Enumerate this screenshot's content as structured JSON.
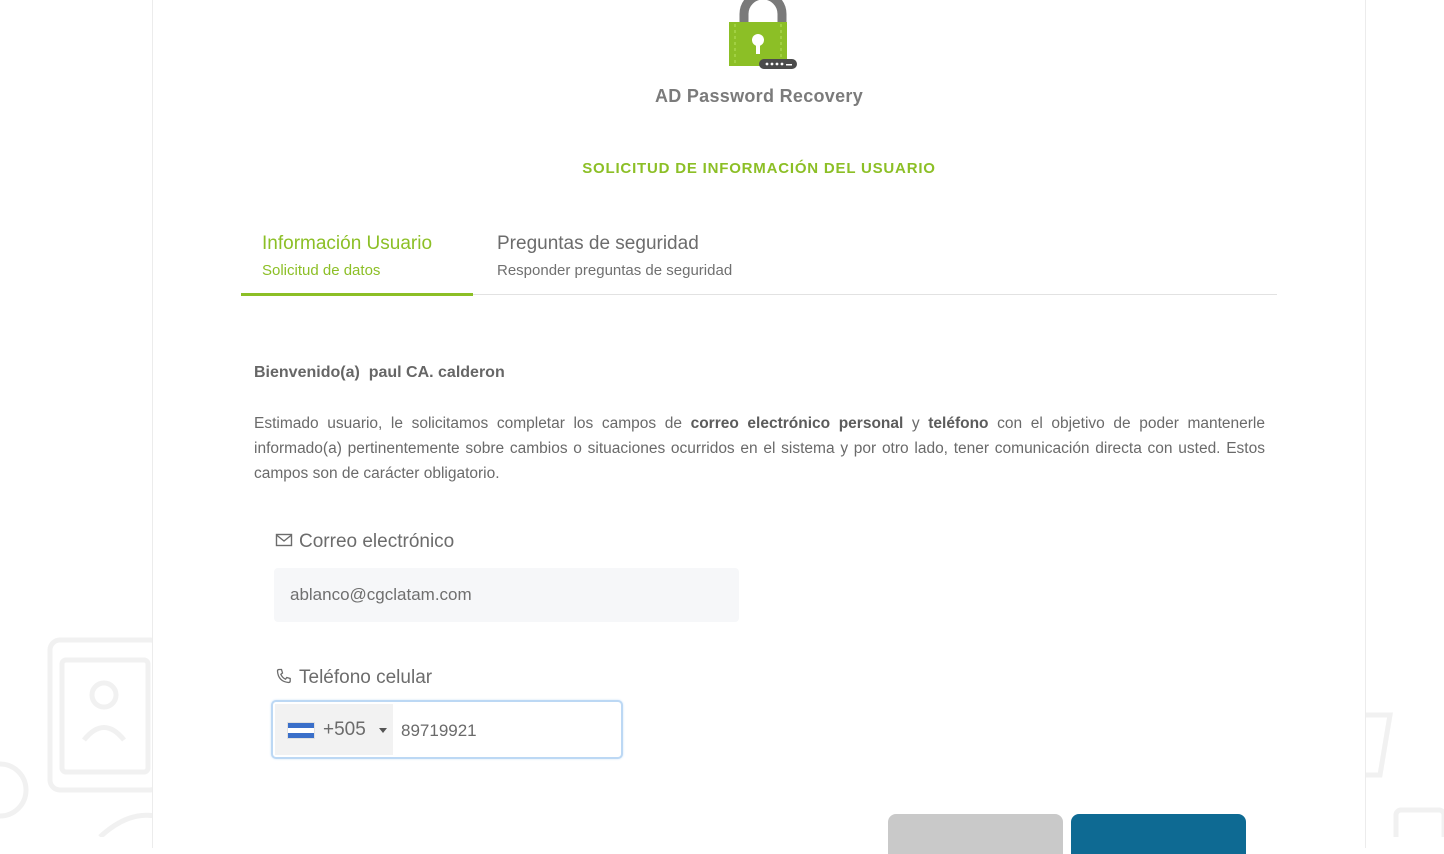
{
  "app": {
    "title": "AD Password Recovery",
    "section_title": "SOLICITUD DE INFORMACIÓN DEL USUARIO"
  },
  "tabs": [
    {
      "title": "Información Usuario",
      "subtitle": "Solicitud de datos",
      "active": true
    },
    {
      "title": "Preguntas de seguridad",
      "subtitle": "Responder preguntas de seguridad",
      "active": false
    }
  ],
  "welcome": {
    "prefix": "Bienvenido(a)",
    "user_name": "paul CA. calderon"
  },
  "description": {
    "part1": "Estimado usuario, le solicitamos completar los campos de ",
    "bold1": "correo electrónico personal",
    "part2": " y ",
    "bold2": "teléfono",
    "part3": " con el objetivo de poder mantenerle informado(a) pertinentemente sobre cambios o situaciones ocurridos en el sistema y por otro lado, tener comunicación directa con usted. Estos campos son de carácter obligatorio."
  },
  "email": {
    "label": "Correo electrónico",
    "value": "ablanco@cgclatam.com",
    "icon": "mail-icon"
  },
  "phone": {
    "label": "Teléfono celular",
    "icon": "phone-icon",
    "country_code": "+505",
    "country_flag": "nicaragua-flag-icon",
    "value": "89719921"
  },
  "colors": {
    "accent_green": "#8cbf26",
    "primary_blue": "#0e6a93",
    "secondary_gray": "#c9c9c9",
    "focus_blue": "#bcd8f4"
  }
}
